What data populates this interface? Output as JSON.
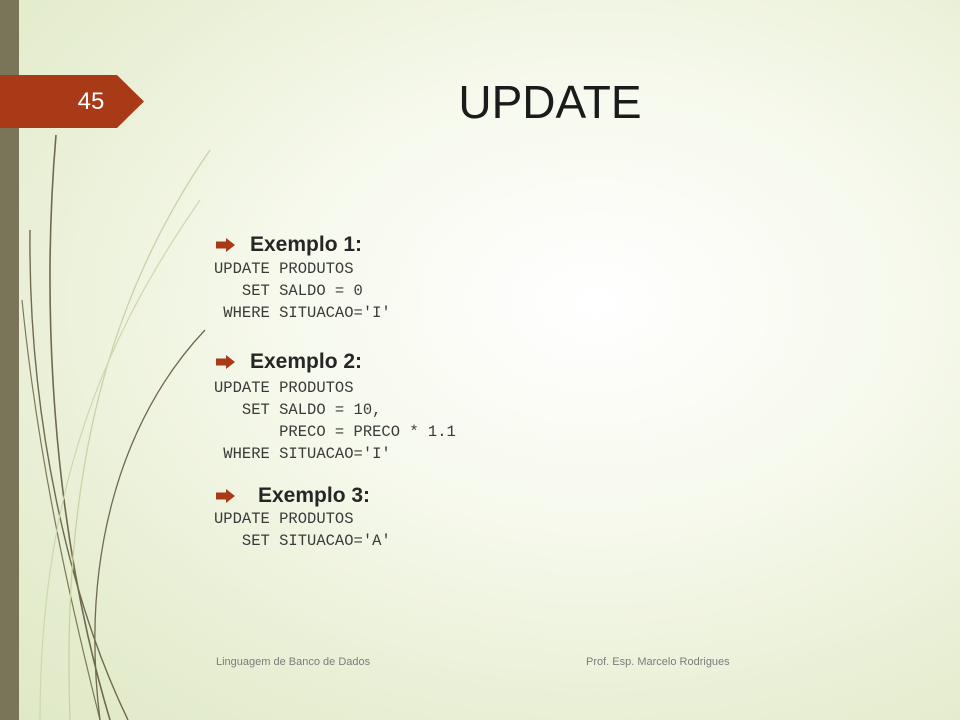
{
  "slide": {
    "number": "45",
    "title": "UPDATE"
  },
  "examples": [
    {
      "label": "Exemplo 1:",
      "code": "UPDATE PRODUTOS\n   SET SALDO = 0\n WHERE SITUACAO='I'"
    },
    {
      "label": "Exemplo 2:",
      "code": "UPDATE PRODUTOS\n   SET SALDO = 10,\n       PRECO = PRECO * 1.1\n WHERE SITUACAO='I'"
    },
    {
      "label": "Exemplo 3:",
      "code": "UPDATE PRODUTOS\n   SET SITUACAO='A'"
    }
  ],
  "footer": {
    "left": "Linguagem de Banco de Dados",
    "right": "Prof. Esp. Marcelo Rodrigues"
  },
  "colors": {
    "accent": "#a93a18",
    "side_bar": "#7a7458",
    "decor_line_dark": "#6f6a4c",
    "decor_line_light": "#c9d2a6"
  },
  "icons": {
    "bullet": "arrow-right-icon"
  }
}
